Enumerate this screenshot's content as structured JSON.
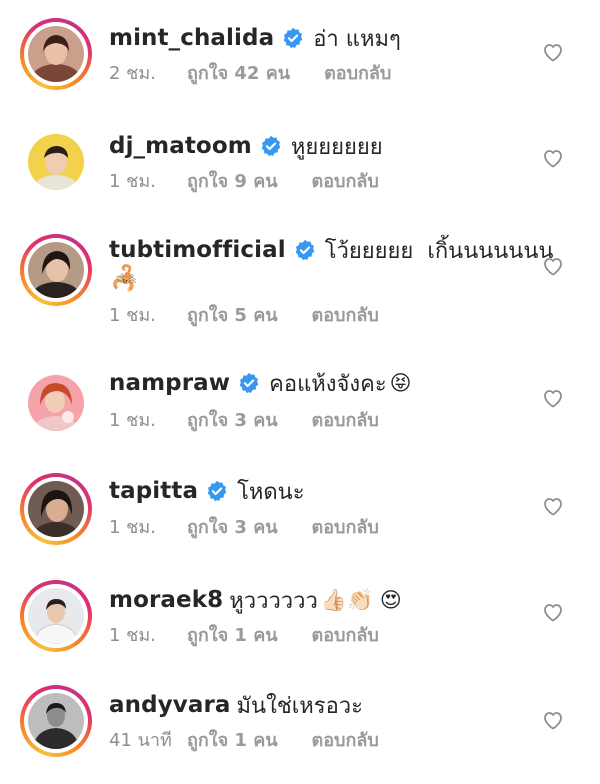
{
  "comments": [
    {
      "username": "mint_chalida",
      "verified": true,
      "text": "อ่า แหมๆ",
      "time": "2 ชม.",
      "likes": "ถูกใจ 42 คน",
      "reply_label": "ตอบกลับ"
    },
    {
      "username": "dj_matoom",
      "verified": true,
      "text": "หูยยยยยย",
      "time": "1 ชม.",
      "likes": "ถูกใจ 9 คน",
      "reply_label": "ตอบกลับ"
    },
    {
      "username": "tubtimofficial",
      "verified": true,
      "text": "โว้ยยยยย  เกิ้นนนนนนน",
      "text_emoji": "🦂",
      "time": "1 ชม.",
      "likes": "ถูกใจ 5 คน",
      "reply_label": "ตอบกลับ"
    },
    {
      "username": "nampraw",
      "verified": true,
      "text": "คอแห้งจังคะ",
      "text_emoji": "😝",
      "time": "1 ชม.",
      "likes": "ถูกใจ 3 คน",
      "reply_label": "ตอบกลับ"
    },
    {
      "username": "tapitta",
      "verified": true,
      "text": "โหดนะ",
      "time": "1 ชม.",
      "likes": "ถูกใจ 3 คน",
      "reply_label": "ตอบกลับ"
    },
    {
      "username": "moraek8",
      "verified": false,
      "text": "หูวววววว",
      "text_emoji": "👍🏻👏🏻 😍",
      "time": "1 ชม.",
      "likes": "ถูกใจ 1 คน",
      "reply_label": "ตอบกลับ"
    },
    {
      "username": "andyvara",
      "verified": false,
      "text": "มันใช่เหรอวะ",
      "time": "41 นาที",
      "likes": "ถูกใจ 1 คน",
      "reply_label": "ตอบกลับ"
    }
  ],
  "colors": {
    "verified_badge": "#3897f0",
    "meta_text": "#8e8e8e",
    "heart_outline": "#8e8e8e"
  },
  "icons": {
    "verified": "verified-badge-icon",
    "like": "heart-outline-icon"
  }
}
